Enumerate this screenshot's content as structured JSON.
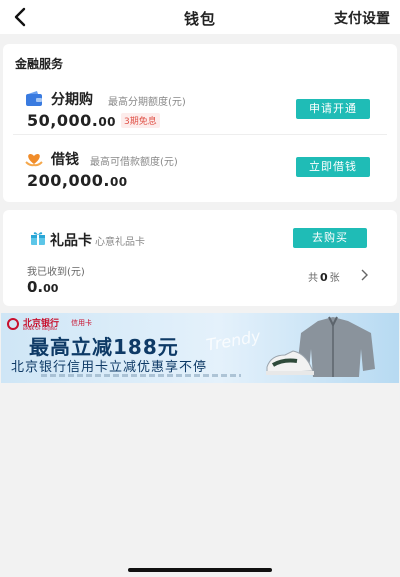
{
  "header": {
    "title": "钱包",
    "pay_settings": "支付设置"
  },
  "finance": {
    "section_title": "金融服务",
    "installment": {
      "name": "分期购",
      "subtitle": "最高分期额度(元)",
      "amount_main": "50,000.",
      "amount_decimal": "00",
      "badge": "3期免息",
      "button": "申请开通",
      "icon": "wallet-icon",
      "icon_color": "#3a7be0"
    },
    "loan": {
      "name": "借钱",
      "subtitle": "最高可借款额度(元)",
      "amount_main": "200,000.",
      "amount_decimal": "00",
      "button": "立即借钱",
      "icon": "heart-hands-icon",
      "icon_color": "#f08c2a"
    }
  },
  "gift": {
    "name": "礼品卡",
    "subtitle": "心意礼品卡",
    "button": "去购买",
    "received_label": "我已收到(元)",
    "received_main": "0.",
    "received_decimal": "00",
    "count_prefix": "共",
    "count_value": "0",
    "count_suffix": "张",
    "icon": "gift-icon"
  },
  "banner": {
    "bank_name": "北京银行",
    "bank_en": "BANK OF BEIJING",
    "card_label": "信用卡",
    "title": "最高立减188元",
    "subtitle": "北京银行信用卡立减优惠享不停",
    "script_text": "Trendy"
  },
  "colors": {
    "accent": "#1fbcb6",
    "badge_red": "#e0544a",
    "banner_navy": "#0e3a66"
  }
}
